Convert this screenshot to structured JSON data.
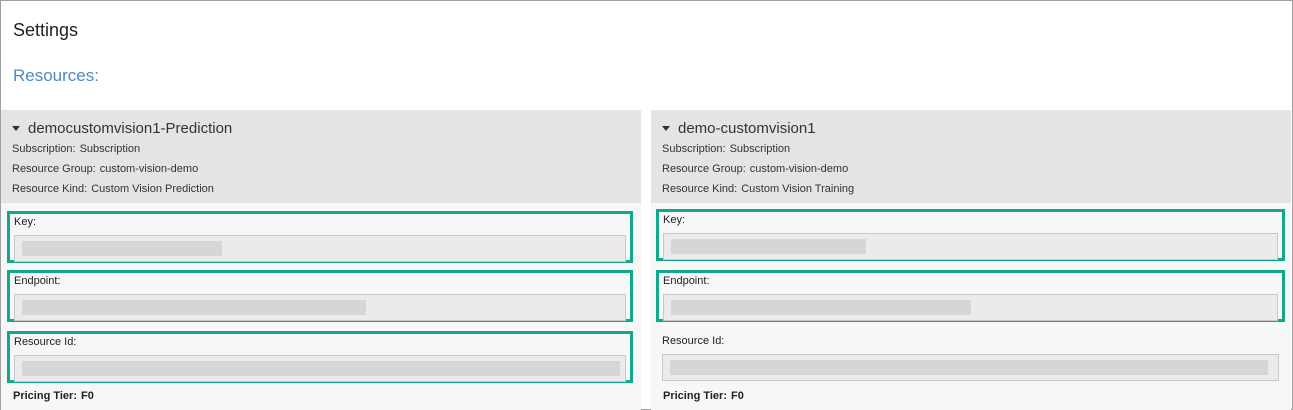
{
  "page": {
    "title": "Settings",
    "section": "Resources:"
  },
  "labels": {
    "subscription": "Subscription:",
    "resource_group": "Resource Group:",
    "resource_kind": "Resource Kind:",
    "key": "Key:",
    "endpoint": "Endpoint:",
    "resource_id": "Resource Id:",
    "pricing_tier": "Pricing Tier:"
  },
  "resources": [
    {
      "name": "democustomvision1-Prediction",
      "subscription": "Subscription",
      "resource_group": "custom-vision-demo",
      "resource_kind": "Custom Vision Prediction",
      "pricing_tier": "F0"
    },
    {
      "name": "demo-customvision1",
      "subscription": "Subscription",
      "resource_group": "custom-vision-demo",
      "resource_kind": "Custom Vision Training",
      "pricing_tier": "F0"
    }
  ],
  "colors": {
    "highlight": "#13a88b",
    "accent": "#4a8ac9"
  }
}
